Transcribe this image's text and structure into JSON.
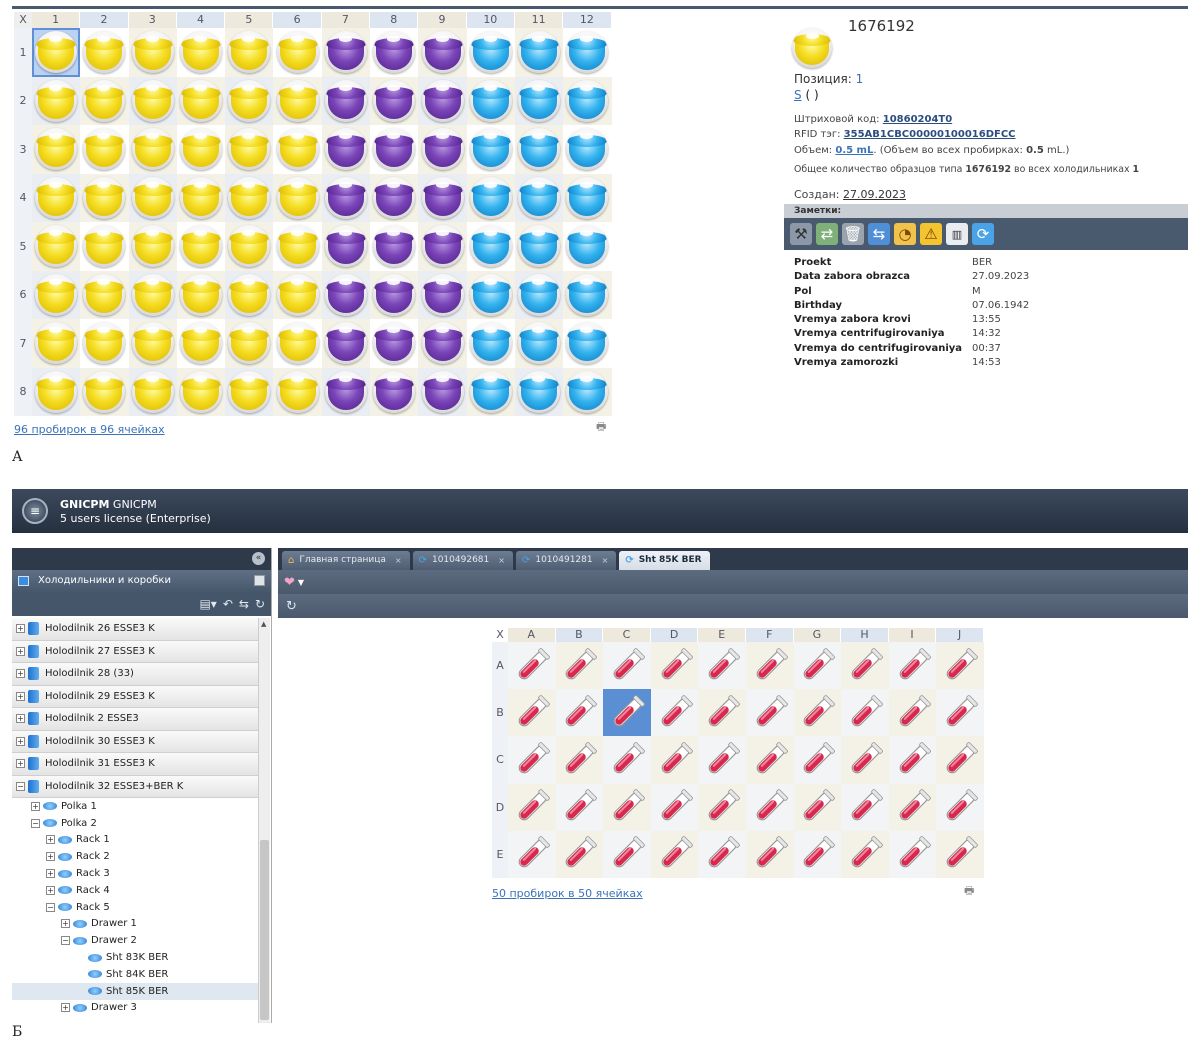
{
  "panelA": {
    "corner": "X",
    "columns": [
      "1",
      "2",
      "3",
      "4",
      "5",
      "6",
      "7",
      "8",
      "9",
      "10",
      "11",
      "12"
    ],
    "rows": [
      "1",
      "2",
      "3",
      "4",
      "5",
      "6",
      "7",
      "8"
    ],
    "column_colors": [
      "y",
      "y",
      "y",
      "y",
      "y",
      "y",
      "p",
      "p",
      "p",
      "b",
      "b",
      "b"
    ],
    "selected_cell": "1-1",
    "footer_link": "96 пробирок в 96 ячейках",
    "label": "А",
    "info": {
      "sample_id": "1676192",
      "position_label": "Позиция:",
      "position_value": "1",
      "s_link": "S",
      "s_rest": "( )",
      "barcode_label": "Штриховой код:",
      "barcode_value": "10860204T0",
      "rfid_label": "RFID тэг:",
      "rfid_value": "355AB1CBC00000100016DFCC",
      "volume_label": "Объем:",
      "volume_value": "0.5 mL",
      "volume_all_prefix": ". (Объем во всех пробирках:",
      "volume_all_value": "0.5",
      "volume_all_suffix": "mL.)",
      "total_prefix": "Общее количество образцов типа",
      "total_id": "1676192",
      "total_mid": "во всех холодильниках",
      "total_count": "1",
      "created_label": "Создан:",
      "created_value": "27.09.2023",
      "notes_label": "Заметки:",
      "fields": [
        {
          "k": "Proekt",
          "v": "BER"
        },
        {
          "k": "Data zabora obrazca",
          "v": "27.09.2023"
        },
        {
          "k": "Pol",
          "v": "M"
        },
        {
          "k": "Birthday",
          "v": "07.06.1942"
        },
        {
          "k": "Vremya zabora krovi",
          "v": "13:55"
        },
        {
          "k": "Vremya centrifugirovaniya",
          "v": "14:32"
        },
        {
          "k": "Vremya do centrifugirovaniya",
          "v": "00:37"
        },
        {
          "k": "Vremya zamorozki",
          "v": "14:53"
        }
      ]
    }
  },
  "panelB": {
    "label": "Б",
    "app": {
      "name_bold": "GNICPM",
      "name_rest": "GNICPM",
      "license": "5 users license (Enterprise)"
    },
    "left_title": "Холодильники и коробки",
    "fridges": [
      {
        "label": "Holodilnik 26 ESSE3 K",
        "expanded": false
      },
      {
        "label": "Holodilnik 27 ESSE3 K",
        "expanded": false
      },
      {
        "label": "Holodilnik 28 (33)",
        "expanded": false
      },
      {
        "label": "Holodilnik 29 ESSE3 K",
        "expanded": false
      },
      {
        "label": "Holodilnik 2 ESSE3",
        "expanded": false
      },
      {
        "label": "Holodilnik 30 ESSE3 K",
        "expanded": false
      },
      {
        "label": "Holodilnik 31 ESSE3 K",
        "expanded": false
      },
      {
        "label": "Holodilnik 32 ESSE3+BER K",
        "expanded": true
      }
    ],
    "subtree": [
      {
        "label": "Polka 1",
        "level": 1,
        "toggle": "+"
      },
      {
        "label": "Polka 2",
        "level": 1,
        "toggle": "−"
      },
      {
        "label": "Rack 1",
        "level": 2,
        "toggle": "+"
      },
      {
        "label": "Rack 2",
        "level": 2,
        "toggle": "+"
      },
      {
        "label": "Rack 3",
        "level": 2,
        "toggle": "+"
      },
      {
        "label": "Rack 4",
        "level": 2,
        "toggle": "+"
      },
      {
        "label": "Rack 5",
        "level": 2,
        "toggle": "−"
      },
      {
        "label": "Drawer 1",
        "level": 3,
        "toggle": "+"
      },
      {
        "label": "Drawer 2",
        "level": 3,
        "toggle": "−"
      },
      {
        "label": "Sht 83K BER",
        "level": 4,
        "toggle": ""
      },
      {
        "label": "Sht 84K BER",
        "level": 4,
        "toggle": ""
      },
      {
        "label": "Sht 85K BER",
        "level": 4,
        "toggle": "",
        "selected": true
      },
      {
        "label": "Drawer 3",
        "level": 3,
        "toggle": "+"
      }
    ],
    "tabs": [
      {
        "label": "Главная страница",
        "icon": "home-icon",
        "active": false
      },
      {
        "label": "1010492681",
        "icon": "refresh-icon",
        "active": false
      },
      {
        "label": "1010491281",
        "icon": "refresh-icon",
        "active": false
      },
      {
        "label": "Sht 85K BER",
        "icon": "refresh-icon",
        "active": true
      }
    ],
    "grid": {
      "corner": "X",
      "columns": [
        "A",
        "B",
        "C",
        "D",
        "E",
        "F",
        "G",
        "H",
        "I",
        "J"
      ],
      "rows": [
        "A",
        "B",
        "C",
        "D",
        "E"
      ],
      "selected_cell": "B-C",
      "footer_link": "50 пробирок в 50 ячейках"
    }
  },
  "colors": {
    "yellow": "#f5dd20",
    "purple": "#7a44b8",
    "blue": "#34b4ef",
    "tube_red": "#d8284d",
    "dark_bar": "#4a5a6e",
    "link": "#3b73b9"
  }
}
